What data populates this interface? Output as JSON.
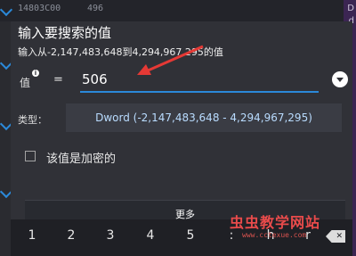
{
  "background": {
    "row_text": "14803C00",
    "row_value": "496",
    "right_chars": [
      "D",
      "d"
    ]
  },
  "dialog": {
    "title": "输入要搜索的值",
    "range_hint": "输入从-2,147,483,648到4,294,967,295的值",
    "value_label": "值",
    "info_icon_glyph": "i",
    "equals_label": "=",
    "value_input": "506",
    "type_label": "类型：",
    "type_selected": "Dword (-2,147,483,648 - 4,294,967,295)",
    "encrypted_label": "该值是加密的",
    "encrypted_checked": false,
    "more_label": "更多"
  },
  "keyboard": {
    "keys": [
      "1",
      "2",
      "3",
      "4",
      "5",
      ":",
      "h",
      "r"
    ]
  },
  "watermark": {
    "text": "虫虫教学网站",
    "sub": "www.cctexue.com"
  },
  "colors": {
    "accent": "#2b89d9",
    "annotation": "#e53935",
    "dialog_bg": "#303137"
  }
}
